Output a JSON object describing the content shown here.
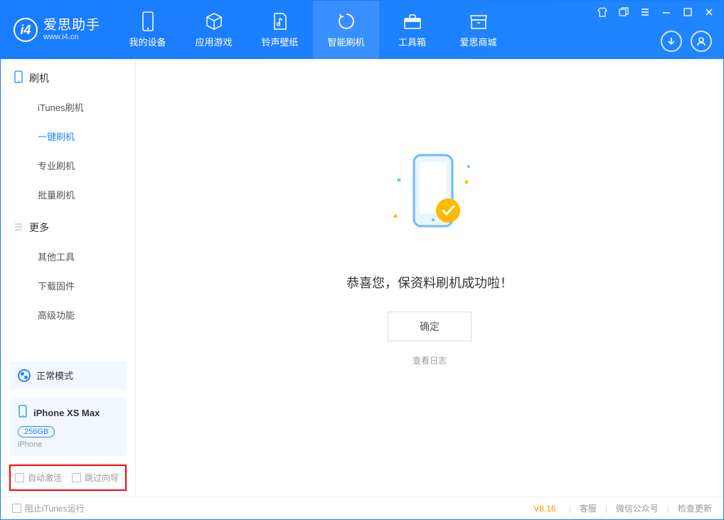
{
  "app": {
    "title": "爱思助手",
    "subtitle": "www.i4.cn"
  },
  "nav": [
    {
      "label": "我的设备"
    },
    {
      "label": "应用游戏"
    },
    {
      "label": "铃声壁纸"
    },
    {
      "label": "智能刷机"
    },
    {
      "label": "工具箱"
    },
    {
      "label": "爱思商城"
    }
  ],
  "sidebar": {
    "section1": {
      "title": "刷机"
    },
    "items1": [
      {
        "label": "iTunes刷机"
      },
      {
        "label": "一键刷机"
      },
      {
        "label": "专业刷机"
      },
      {
        "label": "批量刷机"
      }
    ],
    "section2": {
      "title": "更多"
    },
    "items2": [
      {
        "label": "其他工具"
      },
      {
        "label": "下载固件"
      },
      {
        "label": "高级功能"
      }
    ]
  },
  "mode": {
    "label": "正常模式"
  },
  "device": {
    "name": "iPhone XS Max",
    "capacity": "256GB",
    "type": "iPhone"
  },
  "options": {
    "autoActivate": "自动激活",
    "skipGuide": "跳过向导"
  },
  "main": {
    "successMsg": "恭喜您，保资料刷机成功啦！",
    "confirmBtn": "确定",
    "viewLog": "查看日志"
  },
  "footer": {
    "blockItunes": "阻止iTunes运行",
    "version": "V8.16",
    "support": "客服",
    "wechat": "微信公众号",
    "checkUpdate": "检查更新"
  }
}
